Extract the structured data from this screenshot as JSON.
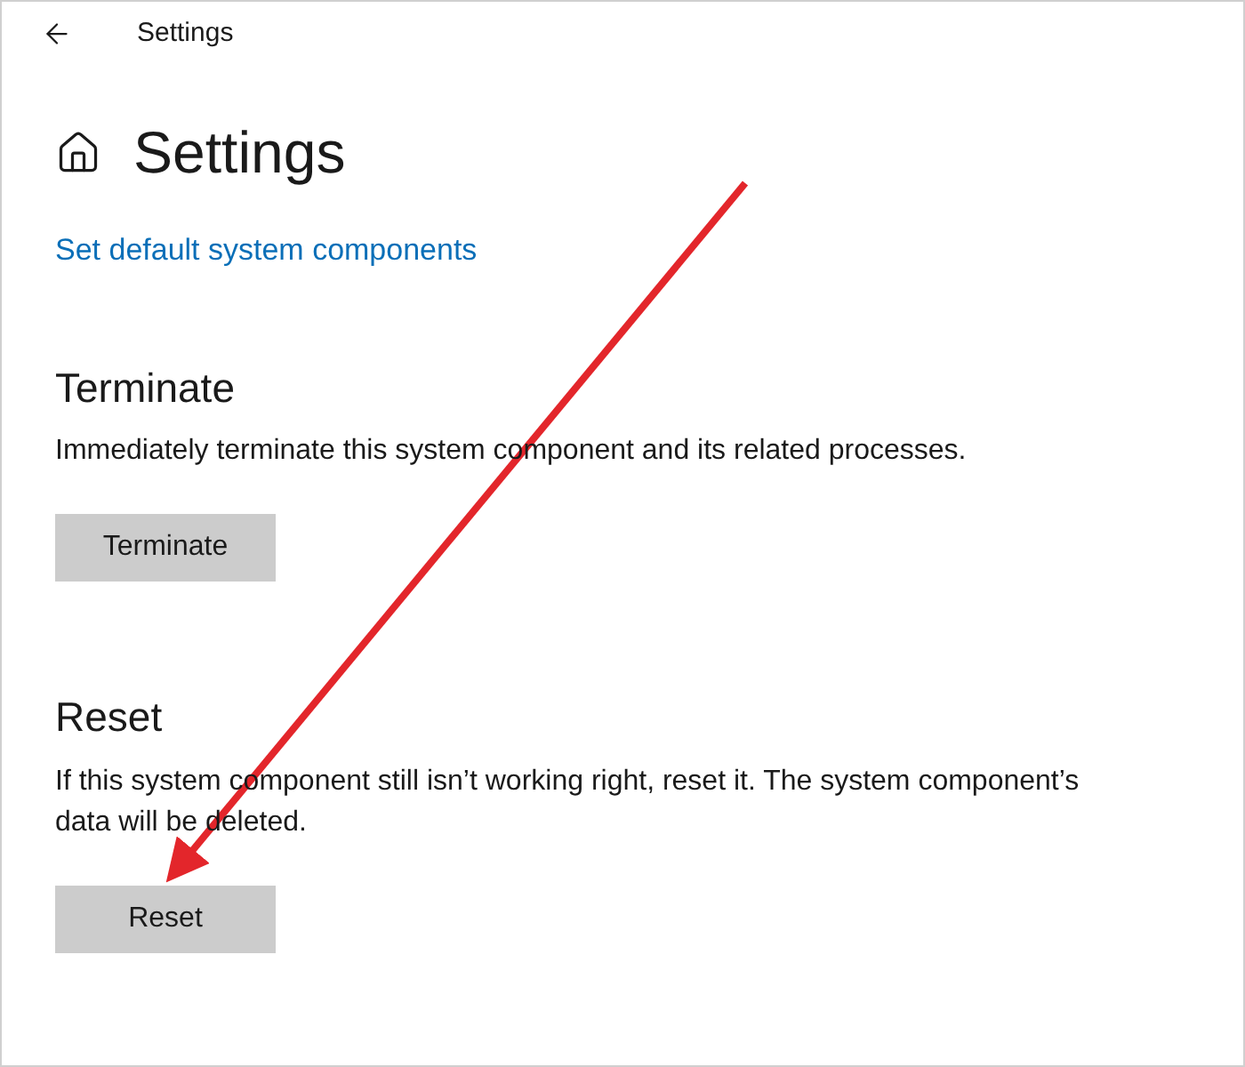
{
  "window": {
    "title": "Settings"
  },
  "page": {
    "title": "Settings",
    "link": "Set default system components"
  },
  "sections": [
    {
      "heading": "Terminate",
      "description": "Immediately terminate this system component and its related processes.",
      "button": "Terminate"
    },
    {
      "heading": "Reset",
      "description": "If this system component still isn’t working right, reset it. The system component’s data will be deleted.",
      "button": "Reset"
    }
  ]
}
